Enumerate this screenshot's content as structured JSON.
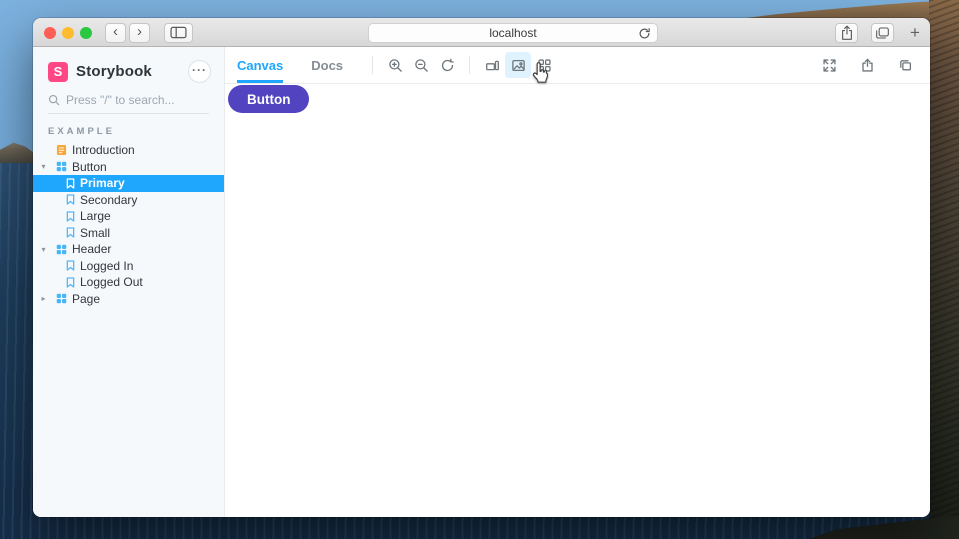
{
  "browser": {
    "url": "localhost",
    "new_tab_label": "+",
    "back_glyph": "‹",
    "forward_glyph": "›",
    "icons": [
      "close-traffic-light",
      "minimize-traffic-light",
      "zoom-traffic-light",
      "back",
      "forward",
      "sidebar-toggle",
      "reload",
      "share",
      "tabs-overview",
      "new-tab"
    ]
  },
  "sidebar": {
    "brand": {
      "logo_letter": "S",
      "title": "Storybook"
    },
    "menu_glyph": "···",
    "search": {
      "placeholder": "Press \"/\" to search..."
    },
    "section_label": "EXAMPLE",
    "tree": [
      {
        "label": "Introduction",
        "type": "document",
        "depth": 0,
        "expandable": false,
        "expanded": false,
        "selected": false
      },
      {
        "label": "Button",
        "type": "component",
        "depth": 0,
        "expandable": true,
        "expanded": true,
        "selected": false
      },
      {
        "label": "Primary",
        "type": "story",
        "depth": 1,
        "expandable": false,
        "expanded": false,
        "selected": true
      },
      {
        "label": "Secondary",
        "type": "story",
        "depth": 1,
        "expandable": false,
        "expanded": false,
        "selected": false
      },
      {
        "label": "Large",
        "type": "story",
        "depth": 1,
        "expandable": false,
        "expanded": false,
        "selected": false
      },
      {
        "label": "Small",
        "type": "story",
        "depth": 1,
        "expandable": false,
        "expanded": false,
        "selected": false
      },
      {
        "label": "Header",
        "type": "component",
        "depth": 0,
        "expandable": true,
        "expanded": true,
        "selected": false
      },
      {
        "label": "Logged In",
        "type": "story",
        "depth": 1,
        "expandable": false,
        "expanded": false,
        "selected": false
      },
      {
        "label": "Logged Out",
        "type": "story",
        "depth": 1,
        "expandable": false,
        "expanded": false,
        "selected": false
      },
      {
        "label": "Page",
        "type": "component",
        "depth": 0,
        "expandable": true,
        "expanded": false,
        "selected": false
      }
    ]
  },
  "toolbar": {
    "tabs": [
      {
        "label": "Canvas",
        "active": true
      },
      {
        "label": "Docs",
        "active": false
      }
    ],
    "left_icons": [
      "zoom-in",
      "zoom-out",
      "zoom-reset",
      "viewport",
      "background",
      "grid"
    ],
    "hovered_icon": "background",
    "right_icons": [
      "fullscreen",
      "share",
      "copy"
    ]
  },
  "canvas": {
    "story_button_label": "Button"
  },
  "colors": {
    "accent": "#1ea7fd",
    "brand": "#ff4785",
    "story_button": "#5243c0",
    "component_icon": "#45b6f7",
    "document_icon": "#f5a73b",
    "selected_text": "#ffffff"
  }
}
